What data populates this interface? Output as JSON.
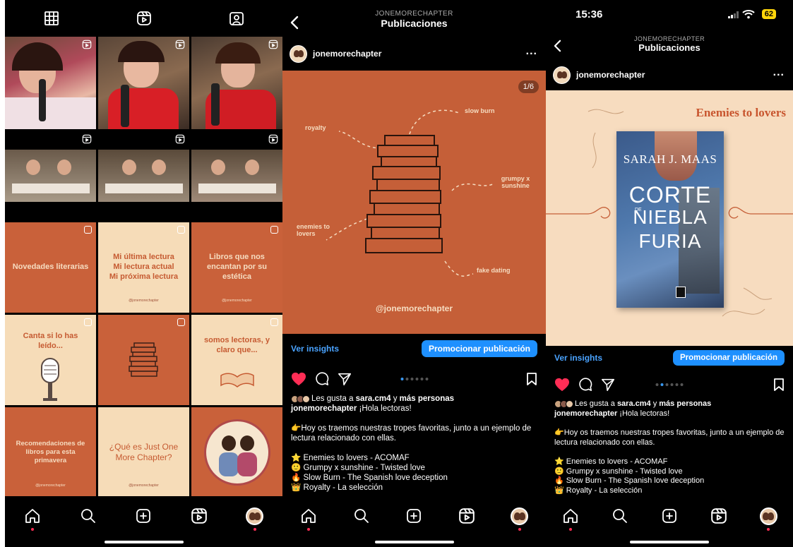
{
  "grid_screen": {
    "tiles": [
      {
        "text": "Novedades literarias",
        "bg": "#c9613a",
        "fg": "#f6dcc0"
      },
      {
        "text": "Mi última lectura\nMi lectura actual\nMi próxima lectura",
        "bg": "#f6dcb8",
        "fg": "#c65b32",
        "tiny": "@jonemorechapter"
      },
      {
        "text": "Libros que nos encantan por su estética",
        "bg": "#c9613a",
        "fg": "#f6dcc0",
        "tiny": "@jonemorechapter"
      },
      {
        "text": "Canta si lo has leído...",
        "bg": "#f6dcb8",
        "fg": "#c65b32"
      },
      {
        "text": "",
        "bg": "#c9613a",
        "fg": "#f6dcc0"
      },
      {
        "text": "somos lectoras, y claro que...",
        "bg": "#f6dcb8",
        "fg": "#c65b32"
      },
      {
        "text": "Recomendaciones de libros para esta primavera",
        "bg": "#c9613a",
        "fg": "#f6dcc0",
        "tiny": "@jonemorechapter"
      },
      {
        "text": "¿Qué es Just One More Chapter?",
        "bg": "#f6dcb8",
        "fg": "#c65b32",
        "tiny": "@jonemorechapter"
      },
      {
        "text": "",
        "bg": "#c9613a",
        "fg": "#f6dcc0"
      }
    ]
  },
  "post_screen": {
    "header_sub": "JONEMORECHAPTER",
    "header_title": "Publicaciones",
    "account": "jonemorechapter",
    "more": "...",
    "counter": "1/6",
    "image_labels": {
      "slow_burn": "slow burn",
      "royalty": "royalty",
      "grumpy": "grumpy x sunshine",
      "enemies": "enemies to lovers",
      "fake": "fake dating",
      "handle": "@jonemorechapter"
    },
    "insights": "Ver insights",
    "promote": "Promocionar publicación",
    "likes_prefix": "Les gusta a ",
    "likes_user": "sara.cm4",
    "likes_mid": " y ",
    "likes_suffix": "más personas",
    "caption_user": "jonemorechapter",
    "caption_greeting": " ¡Hola lectoras!",
    "caption_lines": [
      "👉Hoy os traemos nuestras tropes favoritas, junto a un ejemplo de lectura relacionado con ellas.",
      "⭐ Enemies to lovers - ACOMAF",
      "🙂 Grumpy x sunshine - Twisted love",
      "🔥 Slow Burn - The Spanish love deception",
      "👑 Royalty - La selección"
    ]
  },
  "book_screen": {
    "time": "15:36",
    "battery": "62",
    "trope": "Enemies to lovers",
    "author": "SARAH J. MAAS",
    "title_l1": "CORTE",
    "title_de": "DE",
    "title_l2": "NIEBLA",
    "title_l3": "FURIA"
  },
  "colors": {
    "accent": "#1e90ff",
    "like": "#ff2d55",
    "brand_orange": "#c9613a",
    "cream": "#f6dcb8"
  }
}
